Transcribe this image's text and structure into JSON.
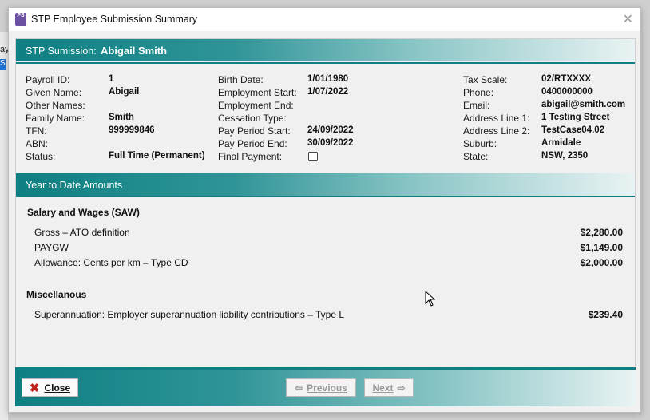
{
  "background": {
    "fragment_text": "ay",
    "selected_text": "S"
  },
  "window": {
    "title": "STP Employee Submission Summary",
    "icon_label": "PS"
  },
  "header_band": {
    "label": "STP Sumission:",
    "employee_name": "Abigail Smith"
  },
  "details": {
    "col1": [
      {
        "label": "Payroll ID:",
        "value": "1"
      },
      {
        "label": "Given Name:",
        "value": "Abigail"
      },
      {
        "label": "Other Names:",
        "value": ""
      },
      {
        "label": "Family Name:",
        "value": "Smith"
      },
      {
        "label": "TFN:",
        "value": "999999846"
      },
      {
        "label": "ABN:",
        "value": ""
      },
      {
        "label": "Status:",
        "value": "Full Time (Permanent)"
      }
    ],
    "col2": [
      {
        "label": "Birth Date:",
        "value": "1/01/1980"
      },
      {
        "label": "Employment Start:",
        "value": "1/07/2022"
      },
      {
        "label": "Employment End:",
        "value": ""
      },
      {
        "label": "Cessation Type:",
        "value": ""
      },
      {
        "label": "Pay Period Start:",
        "value": "24/09/2022"
      },
      {
        "label": "Pay Period End:",
        "value": "30/09/2022"
      },
      {
        "label": "Final Payment:",
        "value": ""
      }
    ],
    "final_payment_checked": false,
    "col3": [
      {
        "label": "Tax Scale:",
        "value": "02/RTXXXX"
      },
      {
        "label": "Phone:",
        "value": "0400000000"
      },
      {
        "label": "Email:",
        "value": "abigail@smith.com"
      },
      {
        "label": "Address Line 1:",
        "value": "1 Testing Street"
      },
      {
        "label": "Address Line 2:",
        "value": "TestCase04.02"
      },
      {
        "label": "Suburb:",
        "value": "Armidale"
      },
      {
        "label": "State:",
        "value": "NSW, 2350"
      }
    ]
  },
  "ytd_band": {
    "label": "Year to Date Amounts"
  },
  "ytd": {
    "saw": {
      "heading": "Salary and Wages  (SAW)",
      "rows": [
        {
          "label": "Gross – ATO definition",
          "amount": "$2,280.00"
        },
        {
          "label": "PAYGW",
          "amount": "$1,149.00"
        },
        {
          "label": "Allowance: Cents per km  –  Type  CD",
          "amount": "$2,000.00"
        }
      ]
    },
    "misc": {
      "heading": "Miscellanous",
      "rows": [
        {
          "label": "Superannuation: Employer superannuation liability contributions  –  Type  L",
          "amount": "$239.40"
        }
      ]
    }
  },
  "footer": {
    "close_label": "Close",
    "previous_label": "Previous",
    "next_label": "Next",
    "previous_enabled": false,
    "next_enabled": false
  },
  "colors": {
    "teal": "#0e7f82",
    "close_icon_red": "#c0201b"
  }
}
